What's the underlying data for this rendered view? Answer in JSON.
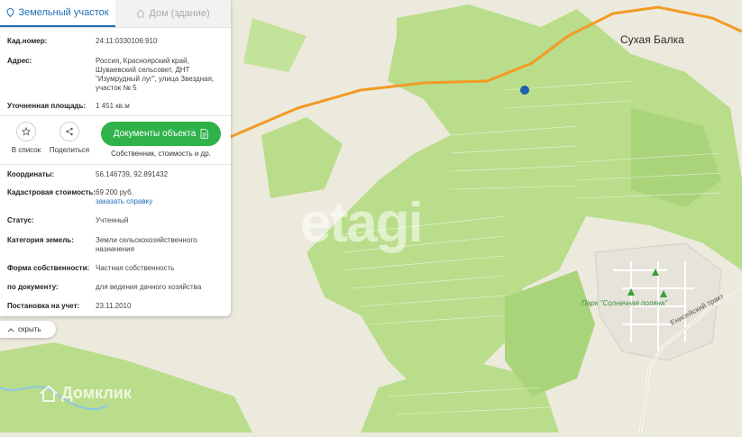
{
  "tabs": [
    {
      "label": "Земельный участок",
      "active": true,
      "icon": "pin-icon"
    },
    {
      "label": "Дом (здание)",
      "active": false,
      "icon": "house-icon"
    }
  ],
  "info": {
    "cad_label": "Кад.номер:",
    "cad_value": "24:11:0330106:910",
    "address_label": "Адрес:",
    "address_value": "Россия, Красноярский край, Шуваевский сельсовет, ДНТ \"Изумрудный луг\", улица Звездная, участок № 5",
    "area_label": "Уточненная площадь:",
    "area_value": "1 451 кв.м"
  },
  "actions": {
    "favorite_label": "В список",
    "share_label": "Поделиться",
    "docs_label": "Документы объекта",
    "docs_sub": "Собственник, стоимость и др."
  },
  "details": {
    "coords_label": "Координаты:",
    "coords_value": "56.146739, 92.891432",
    "cost_label": "Кадастровая стоимость:",
    "cost_value": "69 200 руб.",
    "cost_link": "заказать справку",
    "status_label": "Статус:",
    "status_value": "Учтенный",
    "category_label": "Категория земель:",
    "category_value": "Земли сельскохозяйственного назначения",
    "ownership_label": "Форма собственности:",
    "ownership_value": "Частная собственность",
    "document_label": "по документу:",
    "document_value": "для ведения дачного хозяйства",
    "registered_label": "Постановка на учет:",
    "registered_value": "23.11.2010"
  },
  "hide_label": "скрыть",
  "map": {
    "place_label": "Сухая Балка",
    "park_label": "Парк \"Солнечная поляна\"",
    "road_label": "Енисейский тракт",
    "watermark": "etagi",
    "domclick": "Домклик",
    "colors": {
      "road": "#f39a24",
      "green": "#b5dc86",
      "green_dark": "#9ccc6a",
      "land": "#eceadc",
      "marker": "#1f5fb0"
    }
  }
}
